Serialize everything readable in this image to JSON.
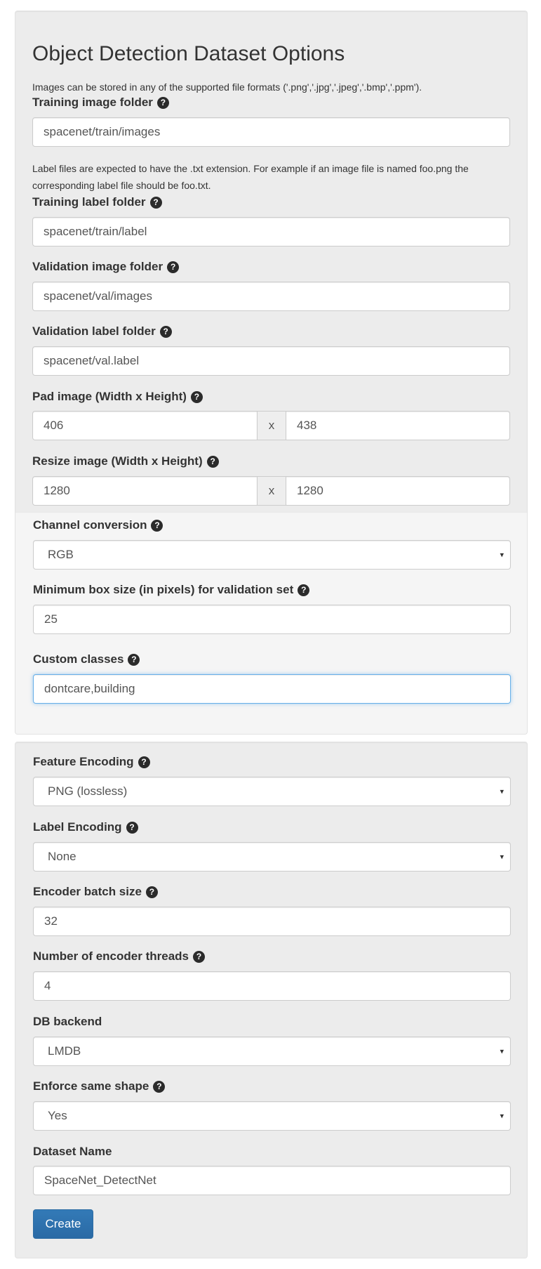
{
  "dataset": {
    "title": "Object Detection Dataset Options",
    "formats_help": "Images can be stored in any of the supported file formats ('.png','.jpg','.jpeg','.bmp','.ppm').",
    "label_help": "Label files are expected to have the .txt extension. For example if an image file is named foo.png the corresponding label file should be foo.txt.",
    "help_icon": "?",
    "training_image_folder": {
      "label": "Training image folder",
      "value": "spacenet/train/images"
    },
    "training_label_folder": {
      "label": "Training label folder",
      "value": "spacenet/train/label"
    },
    "validation_image_folder": {
      "label": "Validation image folder",
      "value": "spacenet/val/images"
    },
    "validation_label_folder": {
      "label": "Validation label folder",
      "value": "spacenet/val.label"
    },
    "pad_image": {
      "label": "Pad image (Width x Height)",
      "width": "406",
      "separator": "x",
      "height": "438"
    },
    "resize_image": {
      "label": "Resize image (Width x Height)",
      "width": "1280",
      "separator": "x",
      "height": "1280"
    },
    "channel_conversion": {
      "label": "Channel conversion",
      "value": "RGB"
    },
    "min_box_size": {
      "label": "Minimum box size (in pixels) for validation set",
      "value": "25"
    },
    "custom_classes": {
      "label": "Custom classes",
      "value": "dontcare,building"
    }
  },
  "encoding": {
    "feature_encoding": {
      "label": "Feature Encoding",
      "value": "PNG (lossless)"
    },
    "label_encoding": {
      "label": "Label Encoding",
      "value": "None"
    },
    "encoder_batch_size": {
      "label": "Encoder batch size",
      "value": "32"
    },
    "encoder_threads": {
      "label": "Number of encoder threads",
      "value": "4"
    },
    "db_backend": {
      "label": "DB backend",
      "value": "LMDB"
    },
    "enforce_same_shape": {
      "label": "Enforce same shape",
      "value": "Yes"
    },
    "dataset_name": {
      "label": "Dataset Name",
      "value": "SpaceNet_DetectNet"
    },
    "create_label": "Create"
  },
  "icons": {
    "help": "question-circle-icon",
    "select": "caret-down-icon"
  },
  "colors": {
    "primary": "#337ab7",
    "focus": "#66afe9"
  }
}
